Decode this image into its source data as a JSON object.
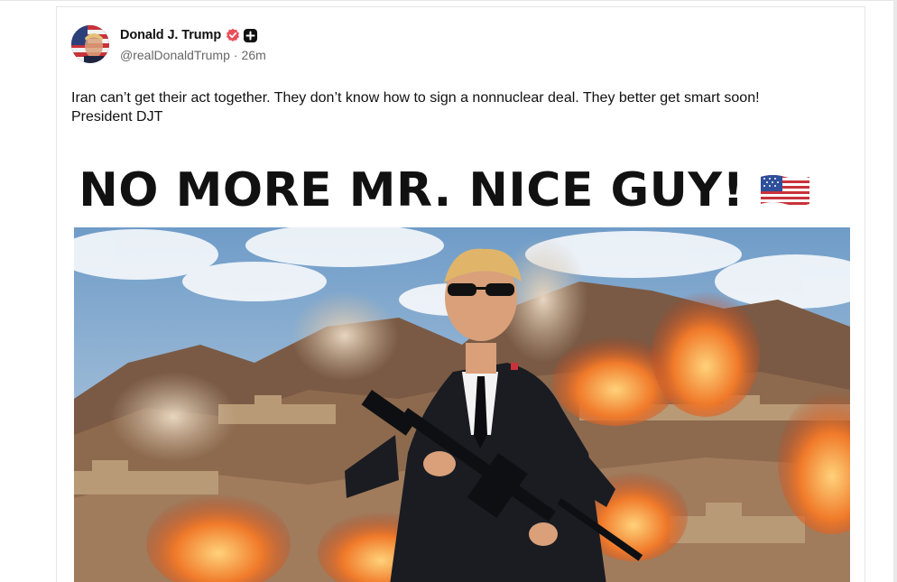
{
  "post": {
    "author": {
      "display_name": "Donald J. Trump",
      "handle": "@realDonaldTrump",
      "separator": "·",
      "time_ago": "26m",
      "verified_icon": "verified-badge-icon",
      "plus_icon": "plus-badge-icon"
    },
    "text_line1": "Iran can’t get their act together. They don’t know how to sign a nonnuclear deal. They better get smart soon!",
    "text_line2": "President DJT",
    "media": {
      "headline": "NO MORE MR. NICE GUY!",
      "emoji": "us-flag-emoji"
    }
  },
  "colors": {
    "verified": "#e8505b",
    "text": "#111111",
    "muted": "#666666",
    "border": "#e5e5e5"
  }
}
